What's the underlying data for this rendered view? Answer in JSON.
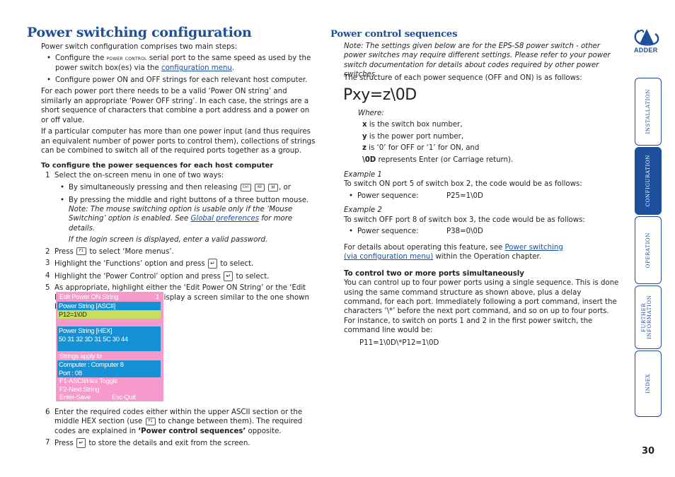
{
  "left": {
    "title": "Power switching configuration",
    "intro": "Power switch configuration comprises two main steps:",
    "steps_bullets": [
      {
        "pre": "Configure the ",
        "smallcaps": "power control",
        "post": " serial port to the same speed as used by the power switch box(es) via the ",
        "link": "configuration menu",
        "end": "."
      },
      {
        "text": "Configure power ON and OFF strings for each relevant host computer."
      }
    ],
    "para1": "For each power port there needs to be a valid ‘Power ON string’ and similarly an appropriate ‘Power OFF string’. In each case, the strings are a short sequence of characters that combine a port address and a power on or off value.",
    "para2": "If a particular computer has more than one power input (and thus requires an equivalent number of power ports to control them), collections of strings can be combined to switch all of the required ports together as a group.",
    "procedure_heading": "To configure the power sequences for each host computer",
    "step1": {
      "num": "1",
      "text": "Select the on-screen menu in one of two ways:"
    },
    "step1_b1_pre": "By simultaneously pressing and then releasing",
    "step1_b1_keys": [
      "Ctrl",
      "Alt",
      "M"
    ],
    "step1_b1_post": ", or",
    "step1_b2": "By pressing the middle and right buttons of a three button mouse.",
    "note_pre": "Note: The mouse switching option is usable only if the ‘Mouse Switching’ option is enabled. See ",
    "note_link": "Global preferences",
    "note_post": " for more details.",
    "login_note": "If the login screen is displayed, enter a valid password.",
    "step2": {
      "num": "2",
      "pre": "Press",
      "key": "F1",
      "post": "to select ‘More menus’."
    },
    "step3": {
      "num": "3",
      "pre": "Highlight the ‘Functions’ option and press",
      "post": "to select."
    },
    "step4": {
      "num": "4",
      "pre": "Highlight the ‘Power Control’ option and press",
      "post": "to select."
    },
    "step5": {
      "num": "5",
      "text": "As appropriate, highlight either the ‘Edit Power ON String’ or the ‘Edit Power OFF String’ options to display a screen similar to the one shown below:"
    },
    "step6": {
      "num": "6",
      "pre": "Enter the required codes either within the upper ASCII section or the middle HEX section (use",
      "key": "F1",
      "mid": "to change between them). The required codes are explained in ",
      "bold": "‘Power control sequences’",
      "post": " opposite."
    },
    "step7": {
      "num": "7",
      "pre": "Press",
      "post": "to store the details and exit from the screen."
    }
  },
  "osd": {
    "title": "Edit Power ON String",
    "page": "1",
    "ascii_label": "Power String [ASCII]",
    "ascii_value": "P12=1\\0D",
    "hex_label": "Power String  [HEX]",
    "hex_value": "50 31 32 3D 31 5C 30 44",
    "applies_label": "Strings apply to",
    "computer": "Computer  :  Computer 8",
    "port": "Port : 08",
    "help1": "F1-ASCII/Hex Toggle",
    "help2": "F2-Next String",
    "help3a": "Enter-Save",
    "help3b": "Esc-Quit",
    "colors": {
      "background": "#f59acb",
      "highlight": "#1591d6",
      "selected": "#c9df5c"
    }
  },
  "right": {
    "title": "Power control sequences",
    "note": "Note: The settings given below are for the EPS-S8 power switch - other power switches may require different settings. Please refer to your power switch documentation for details about codes required by other power switches.",
    "structure": "The structure of each power sequence (OFF and ON) is as follows:",
    "formula": "Pxy=z\\0D",
    "where": "Where:",
    "defs": [
      {
        "term": "x",
        "text": " is the switch box number,"
      },
      {
        "term": "y",
        "text": " is the power port number,"
      },
      {
        "term": "z",
        "text": " is ‘0’ for OFF or ‘1’ for ON, and"
      },
      {
        "term": "\\0D",
        "text": " represents Enter (or Carriage return)."
      }
    ],
    "ex1_label": "Example 1",
    "ex1_text": "To switch ON port 5 of switch box 2, the code would be as follows:",
    "ex1_seq_label": "Power sequence:",
    "ex1_seq": "P25=1\\0D",
    "ex2_label": "Example 2",
    "ex2_text": "To switch OFF port 8 of switch box 3, the code would be as follows:",
    "ex2_seq_label": "Power sequence:",
    "ex2_seq": "P38=0\\0D",
    "details_pre": "For details about operating this feature, see ",
    "details_link": "Power switching (via configuration menu)",
    "details_post": " within the Operation chapter.",
    "multi_heading": "To control two or more ports simultaneously",
    "multi_text": "You can control up to four power ports using a single sequence. This is done using the same command structure as shown above, plus a delay command, for each port. Immediately following a port command, insert the characters ‘\\*’ before the next port command, and so on up to four ports. For instance, to switch on ports 1 and 2 in the first power switch, the command line would be:",
    "multi_example": "P11=1\\0D\\*P12=1\\0D"
  },
  "sidebar": {
    "logo": "ADDER",
    "tabs": [
      {
        "label": "INSTALLATION",
        "active": false
      },
      {
        "label": "CONFIGURATION",
        "active": true
      },
      {
        "label": "OPERATION",
        "active": false
      },
      {
        "label": "FURTHER INFORMATION",
        "active": false
      },
      {
        "label": "INDEX",
        "active": false
      }
    ],
    "accent": "#1d4f9c"
  },
  "page_number": "30"
}
